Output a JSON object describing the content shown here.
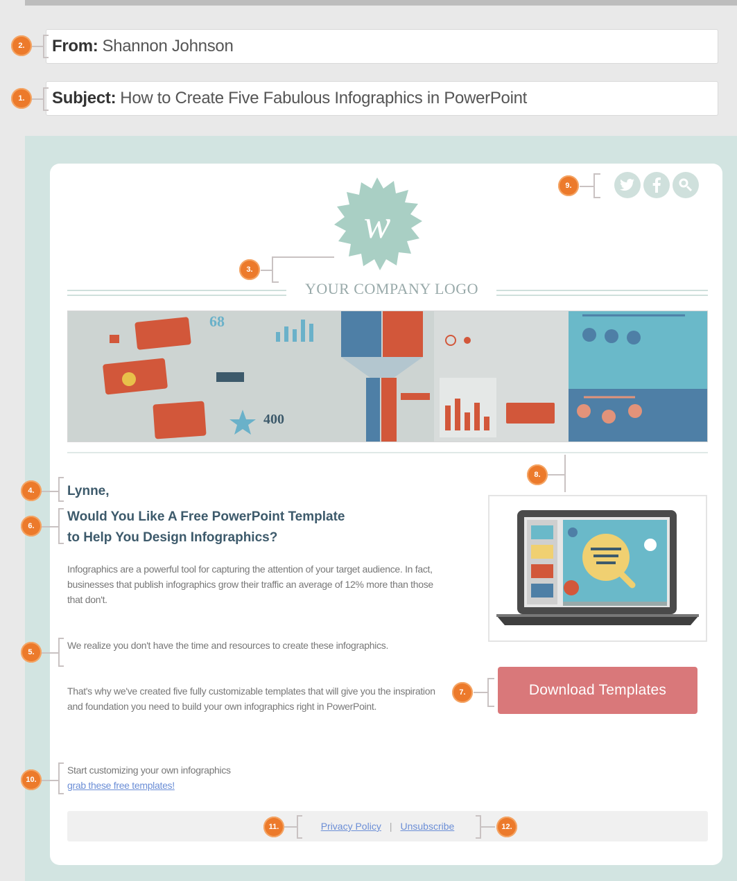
{
  "email": {
    "from_label": "From:",
    "from_value": "Shannon Johnson",
    "subject_label": "Subject:",
    "subject_value": "How to Create Five Fabulous Infographics in PowerPoint"
  },
  "markers": [
    "1.",
    "2.",
    "3.",
    "4.",
    "5.",
    "6.",
    "7.",
    "8.",
    "9.",
    "10.",
    "11.",
    "12."
  ],
  "logo": {
    "text": "YOUR COMPANY LOGO",
    "monogram": "w"
  },
  "hero": {
    "stat_1": "68",
    "stat_2": "400"
  },
  "body": {
    "greeting": "Lynne,",
    "headline_1": "Would You Like A Free PowerPoint Template",
    "headline_2": "to Help You Design Infographics?",
    "p1": "Infographics are a powerful tool for capturing the attention of your target audience. In fact, businesses that publish infographics grow their traffic an average of 12% more than those that don't.",
    "p2": "We realize you don't have the time and resources to create these infographics.",
    "p3": "That's why we've created five fully customizable templates that will give you the inspiration and foundation you need to build your own infographics right in PowerPoint.",
    "p4": "Start customizing your own infographics",
    "p4_link": "grab these free templates!"
  },
  "cta": {
    "label": "Download Templates"
  },
  "footer": {
    "privacy": "Privacy Policy",
    "separator": "|",
    "unsubscribe": "Unsubscribe"
  },
  "social": [
    "twitter-icon",
    "facebook-icon",
    "google-plus-icon"
  ],
  "colors": {
    "accent": "#ec7a2b",
    "cta": "#d9787a",
    "canvas": "#d2e4e1",
    "heading": "#3d5a6b",
    "link": "#6b8ed6"
  }
}
